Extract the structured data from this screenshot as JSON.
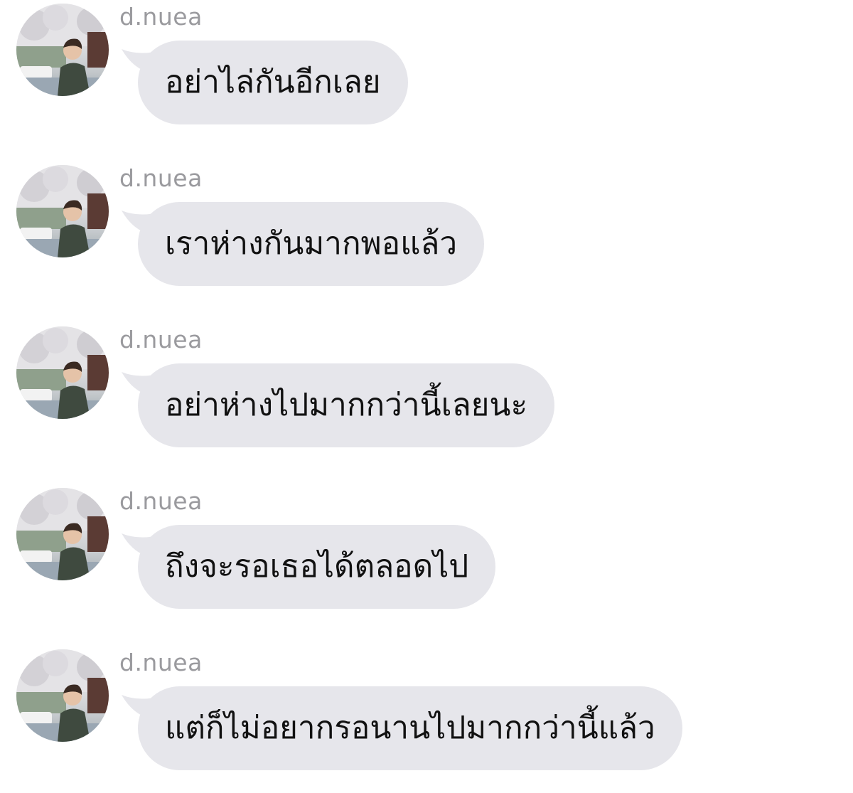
{
  "conversation": {
    "messages": [
      {
        "sender": "d.nuea",
        "text": "อย่าไล่กันอีกเลย",
        "avatar_icon": "profile-photo"
      },
      {
        "sender": "d.nuea",
        "text": "เราห่างกันมากพอแล้ว",
        "avatar_icon": "profile-photo"
      },
      {
        "sender": "d.nuea",
        "text": "อย่าห่างไปมากกว่านี้เลยนะ",
        "avatar_icon": "profile-photo"
      },
      {
        "sender": "d.nuea",
        "text": "ถึงจะรอเธอได้ตลอดไป",
        "avatar_icon": "profile-photo"
      },
      {
        "sender": "d.nuea",
        "text": "แต่ก็ไม่อยากรอนานไปมากกว่านี้แล้ว",
        "avatar_icon": "profile-photo"
      }
    ]
  },
  "colors": {
    "background": "#ffffff",
    "bubble": "#e6e6eb",
    "sender_text": "#9a9a9e",
    "message_text": "#111111"
  }
}
